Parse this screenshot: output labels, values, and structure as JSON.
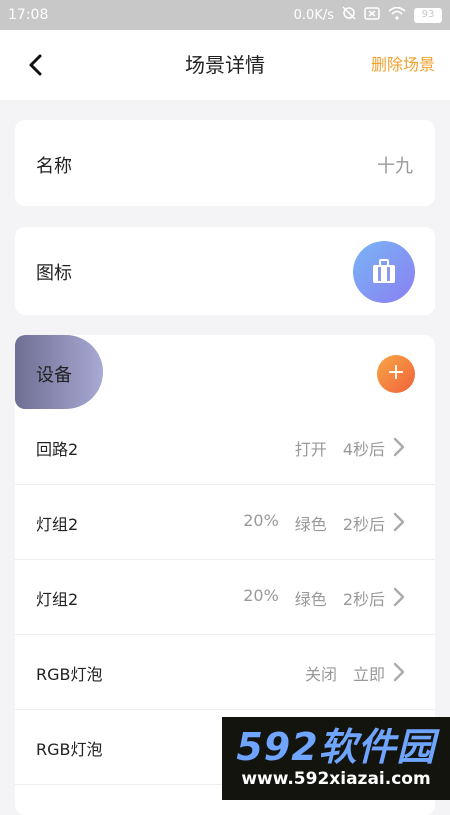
{
  "status_bar": {
    "time": "17:08",
    "net_speed": "0.0K/s",
    "battery": "93",
    "icons": [
      "alarm-off-icon",
      "sim-x-icon",
      "wifi-icon",
      "battery-icon"
    ]
  },
  "header": {
    "title": "场景详情",
    "delete_label": "删除场景",
    "back_icon": "back-chevron-icon",
    "accent_color": "#f1a12e"
  },
  "name_card": {
    "label": "名称",
    "value": "十九"
  },
  "icon_card": {
    "label": "图标",
    "icon": "luggage-icon"
  },
  "devices": {
    "label": "设备",
    "add_label": "+",
    "items": [
      {
        "name": "回路2",
        "action": "打开",
        "delay": "4秒后"
      },
      {
        "name": "灯组2",
        "brightness": "20%",
        "color": "绿色",
        "delay": "2秒后"
      },
      {
        "name": "灯组2",
        "brightness": "20%",
        "color": "绿色",
        "delay": "2秒后"
      },
      {
        "name": "RGB灯泡",
        "action": "关闭",
        "delay": "立即"
      },
      {
        "name": "RGB灯泡"
      }
    ]
  },
  "watermark": {
    "logo": "592软件园",
    "url": "www.592xiazai.com"
  }
}
